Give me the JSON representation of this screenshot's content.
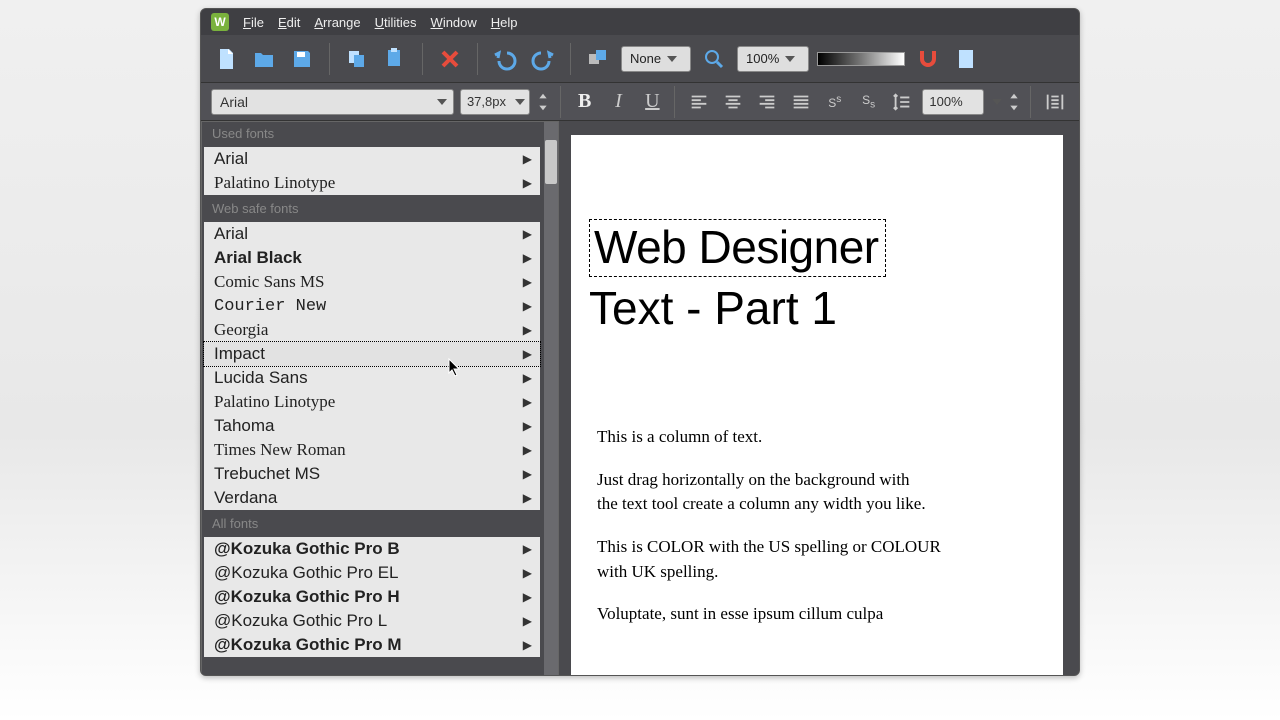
{
  "menu": {
    "items": [
      "File",
      "Edit",
      "Arrange",
      "Utilities",
      "Window",
      "Help"
    ]
  },
  "toolbar": {
    "snap_mode": "None",
    "zoom": "100%"
  },
  "text_toolbar": {
    "font": "Arial",
    "size": "37,8px",
    "line_spacing": "100%"
  },
  "font_dropdown": {
    "sections": [
      {
        "title": "Used fonts",
        "items": [
          {
            "label": "Arial",
            "family": "Arial, sans-serif"
          },
          {
            "label": "Palatino Linotype",
            "family": "'Palatino Linotype', Georgia, serif"
          }
        ]
      },
      {
        "title": "Web safe fonts",
        "items": [
          {
            "label": "Arial",
            "family": "Arial, sans-serif"
          },
          {
            "label": "Arial Black",
            "family": "'Arial Black', sans-serif",
            "weight": "bold"
          },
          {
            "label": "Comic Sans MS",
            "family": "'Comic Sans MS', cursive"
          },
          {
            "label": "Courier New",
            "family": "'Courier New', monospace"
          },
          {
            "label": "Georgia",
            "family": "Georgia, serif"
          },
          {
            "label": "Impact",
            "family": "Impact, 'Arial Black', sans-serif",
            "hover": true
          },
          {
            "label": "Lucida Sans",
            "family": "'Lucida Sans', 'Lucida Grande', sans-serif"
          },
          {
            "label": "Palatino Linotype",
            "family": "'Palatino Linotype', Georgia, serif"
          },
          {
            "label": "Tahoma",
            "family": "Tahoma, sans-serif"
          },
          {
            "label": "Times New Roman",
            "family": "'Times New Roman', serif"
          },
          {
            "label": "Trebuchet MS",
            "family": "'Trebuchet MS', sans-serif"
          },
          {
            "label": "Verdana",
            "family": "Verdana, sans-serif"
          }
        ]
      },
      {
        "title": "All fonts",
        "items": [
          {
            "label": "@Kozuka Gothic Pro B",
            "family": "Arial, sans-serif",
            "weight": "bold"
          },
          {
            "label": "@Kozuka Gothic Pro EL",
            "family": "Arial, sans-serif"
          },
          {
            "label": "@Kozuka Gothic Pro H",
            "family": "Arial, sans-serif",
            "weight": "bold"
          },
          {
            "label": "@Kozuka Gothic Pro L",
            "family": "Arial, sans-serif"
          },
          {
            "label": "@Kozuka Gothic Pro M",
            "family": "Arial, sans-serif",
            "weight": "bold"
          }
        ]
      }
    ]
  },
  "document": {
    "title": "Web Designer",
    "subtitle": "Text - Part 1",
    "body": {
      "p1": "This is a column of text.",
      "p2a": "Just drag horizontally on the background with",
      "p2b": "the text tool create a column any width you like.",
      "p3": "This is COLOR with the US spelling or COLOUR with UK spelling.",
      "p4": "Voluptate, sunt in esse ipsum cillum culpa"
    }
  }
}
